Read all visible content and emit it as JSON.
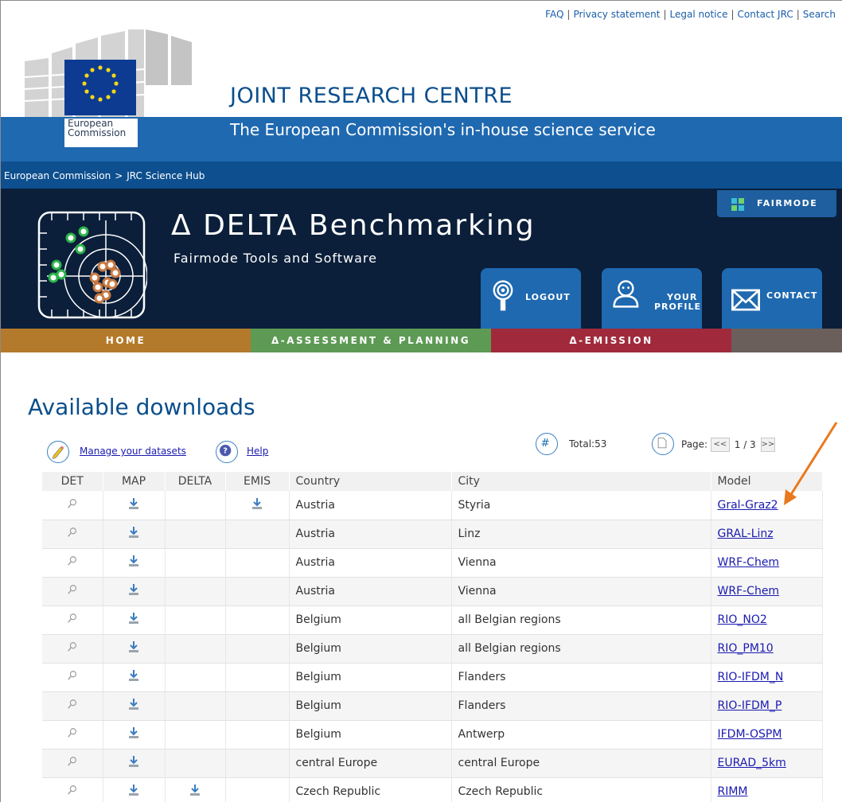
{
  "top_links": [
    "FAQ",
    "Privacy statement",
    "Legal notice",
    "Contact JRC",
    "Search"
  ],
  "header": {
    "org_title": "JOINT RESEARCH CENTRE",
    "tagline": "The European Commission's in-house science service",
    "ec_label_line1": "European",
    "ec_label_line2": "Commission"
  },
  "breadcrumb": {
    "item1": "European Commission",
    "separator": ">",
    "item2": "JRC Science Hub"
  },
  "banner": {
    "title": "Δ DELTA Benchmarking",
    "subtitle": "Fairmode Tools and Software",
    "fairmode_label": "FAIRMODE",
    "logout_label": "LOGOUT",
    "profile_line1": "YOUR",
    "profile_line2": "PROFILE",
    "contact_label": "CONTACT"
  },
  "menu": {
    "home": "HOME",
    "assessment": "Δ-ASSESSMENT & PLANNING",
    "emission": "Δ-EMISSION"
  },
  "content": {
    "page_title": "Available downloads",
    "manage_link": "Manage your datasets",
    "help_link": "Help",
    "total_label": "Total:53",
    "page_label": "Page:",
    "page_prev": "<<",
    "page_value": "1 / 3",
    "page_next": ">>"
  },
  "table": {
    "headers": [
      "DET",
      "MAP",
      "DELTA",
      "EMIS",
      "Country",
      "City",
      "Model"
    ],
    "rows": [
      {
        "country": "Austria",
        "city": "Styria",
        "model": "Gral-Graz2",
        "delta": false,
        "emis": true
      },
      {
        "country": "Austria",
        "city": "Linz",
        "model": "GRAL-Linz",
        "delta": false,
        "emis": false
      },
      {
        "country": "Austria",
        "city": "Vienna",
        "model": "WRF-Chem",
        "delta": false,
        "emis": false
      },
      {
        "country": "Austria",
        "city": "Vienna",
        "model": "WRF-Chem",
        "delta": false,
        "emis": false
      },
      {
        "country": "Belgium",
        "city": "all Belgian regions",
        "model": "RIO_NO2",
        "delta": false,
        "emis": false
      },
      {
        "country": "Belgium",
        "city": "all Belgian regions",
        "model": "RIO_PM10",
        "delta": false,
        "emis": false
      },
      {
        "country": "Belgium",
        "city": "Flanders",
        "model": "RIO-IFDM_N",
        "delta": false,
        "emis": false
      },
      {
        "country": "Belgium",
        "city": "Flanders",
        "model": "RIO-IFDM_P",
        "delta": false,
        "emis": false
      },
      {
        "country": "Belgium",
        "city": "Antwerp",
        "model": "IFDM-OSPM",
        "delta": false,
        "emis": false
      },
      {
        "country": "central Europe",
        "city": "central Europe",
        "model": "EURAD_5km",
        "delta": false,
        "emis": false
      },
      {
        "country": "Czech Republic",
        "city": "Czech Republic",
        "model": "RIMM",
        "delta": true,
        "emis": false
      }
    ]
  },
  "colors": {
    "brand_blue": "#1f69b0",
    "dark_blue": "#0d4f8f",
    "banner_bg": "#0b1f3a",
    "home": "#b47a2b",
    "assessment": "#5d9a54",
    "emission": "#a02a3c",
    "link": "#1a1ab0",
    "annotation_arrow": "#e8791c"
  }
}
